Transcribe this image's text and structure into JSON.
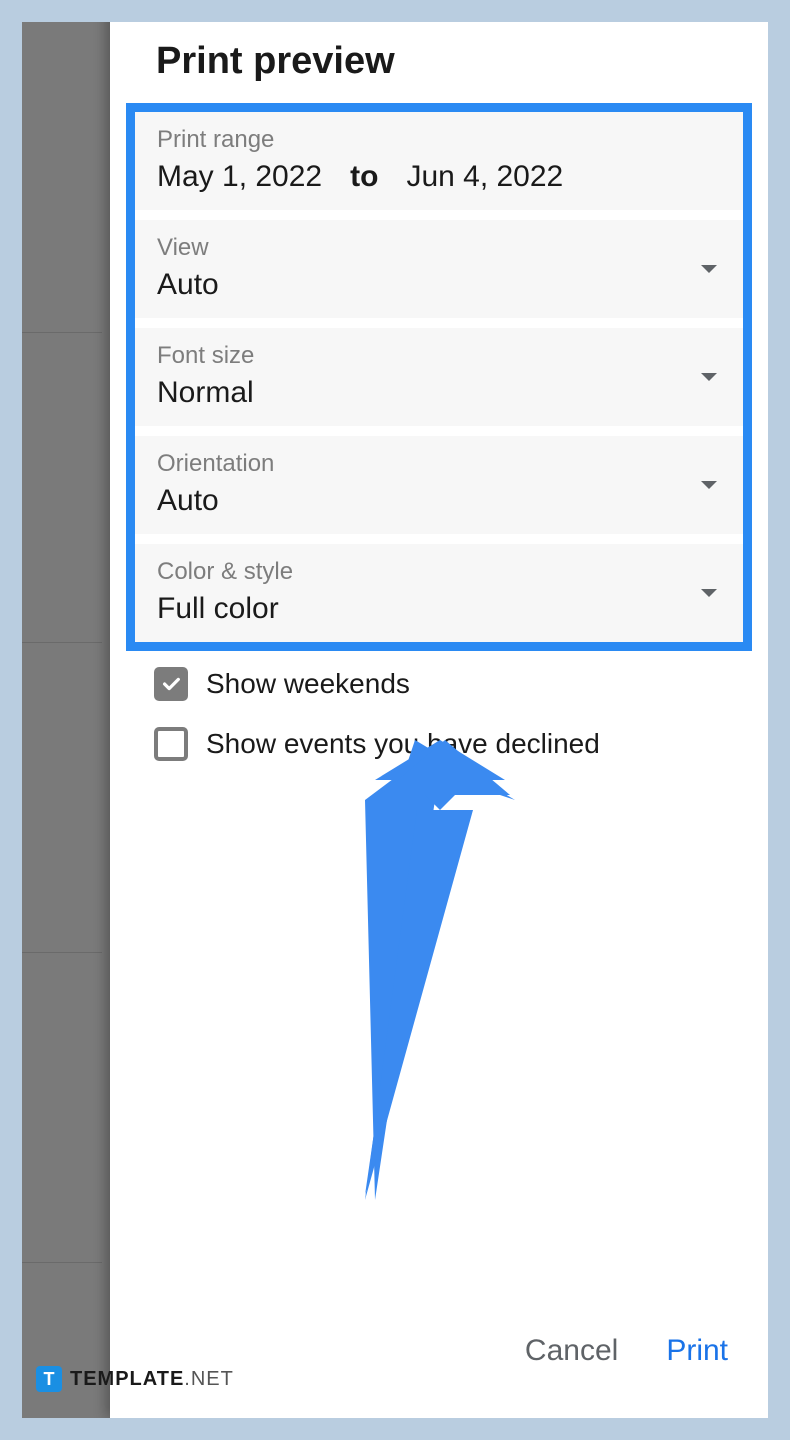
{
  "title": "Print preview",
  "printRange": {
    "label": "Print range",
    "start": "May 1, 2022",
    "to": "to",
    "end": "Jun 4, 2022"
  },
  "view": {
    "label": "View",
    "value": "Auto"
  },
  "fontSize": {
    "label": "Font size",
    "value": "Normal"
  },
  "orientation": {
    "label": "Orientation",
    "value": "Auto"
  },
  "colorStyle": {
    "label": "Color & style",
    "value": "Full color"
  },
  "showWeekends": {
    "label": "Show weekends",
    "checked": true
  },
  "showDeclined": {
    "label": "Show events you have declined",
    "checked": false
  },
  "buttons": {
    "cancel": "Cancel",
    "print": "Print"
  },
  "watermark": {
    "badge": "T",
    "brand1": "TEMPLATE",
    "brand2": ".NET"
  }
}
